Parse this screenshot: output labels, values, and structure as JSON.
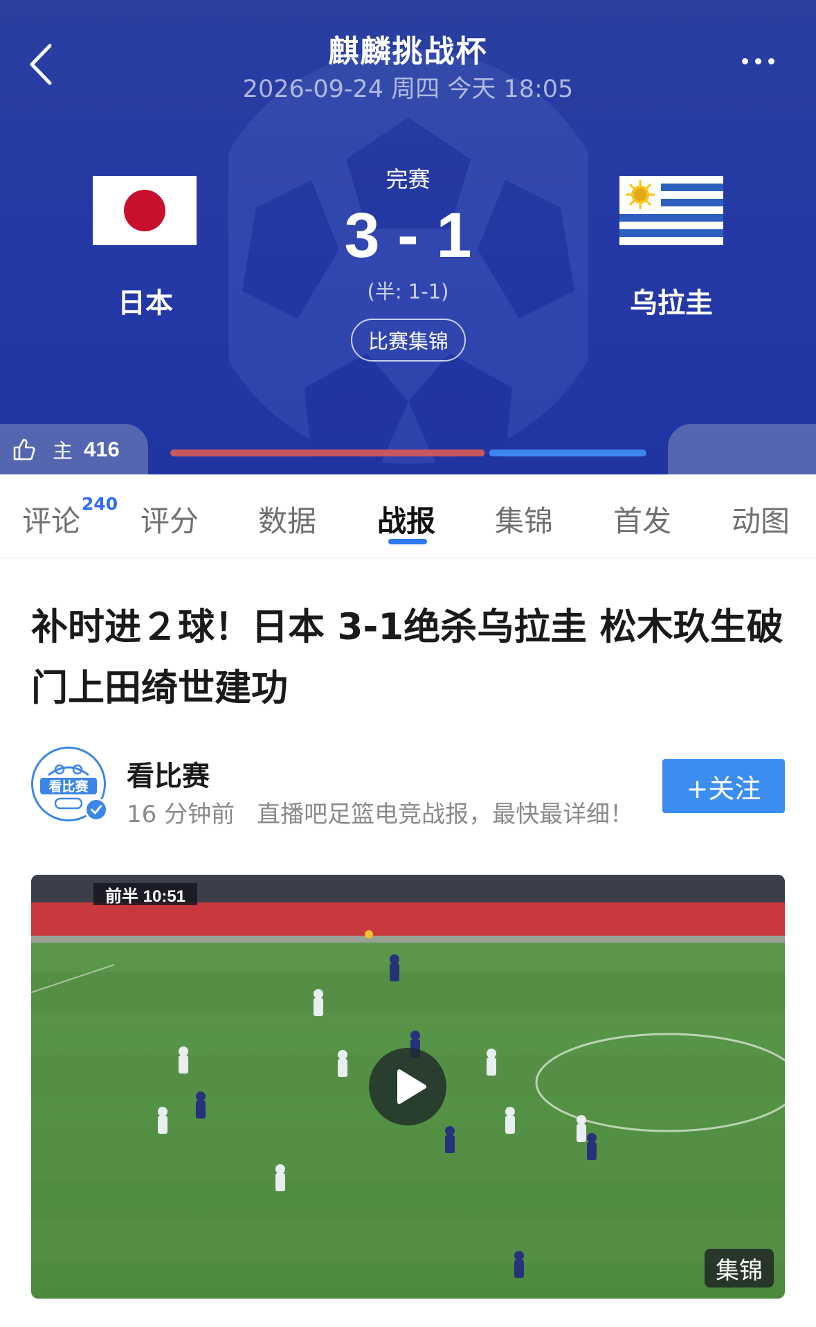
{
  "header": {
    "title": "麒麟挑战杯",
    "datetime": "2026-09-24 周四 今天 18:05",
    "status": "完赛",
    "score": "3 - 1",
    "halftime": "(半: 1-1)",
    "highlights_button": "比赛集锦",
    "home_team": "日本",
    "away_team": "乌拉圭",
    "home_likes_side": "主",
    "home_likes_count": "416",
    "vote_split": {
      "home": 0.665,
      "away": 0.335
    },
    "colors": {
      "background": "#2438a6",
      "home_bar": "#c9575e",
      "away_bar": "#3d84ee"
    }
  },
  "tabs": [
    {
      "label": "评论",
      "badge": "240"
    },
    {
      "label": "评分"
    },
    {
      "label": "数据"
    },
    {
      "label": "战报",
      "active": true
    },
    {
      "label": "集锦"
    },
    {
      "label": "首发"
    },
    {
      "label": "动图"
    }
  ],
  "article": {
    "title": "补时进２球！日本 3-1绝杀乌拉圭 松木玖生破门上田绮世建功",
    "author": {
      "name": "看比赛",
      "avatar_text": "看比赛",
      "time": "16 分钟前",
      "description": "直播吧足篮电竞战报，最快最详细！",
      "follow_label": "+关注"
    },
    "video": {
      "clock": "前半 10:51",
      "tag": "集锦"
    }
  },
  "icons": [
    "back-arrow-icon",
    "more-icon",
    "thumbs-up-icon",
    "play-icon",
    "verified-icon"
  ]
}
